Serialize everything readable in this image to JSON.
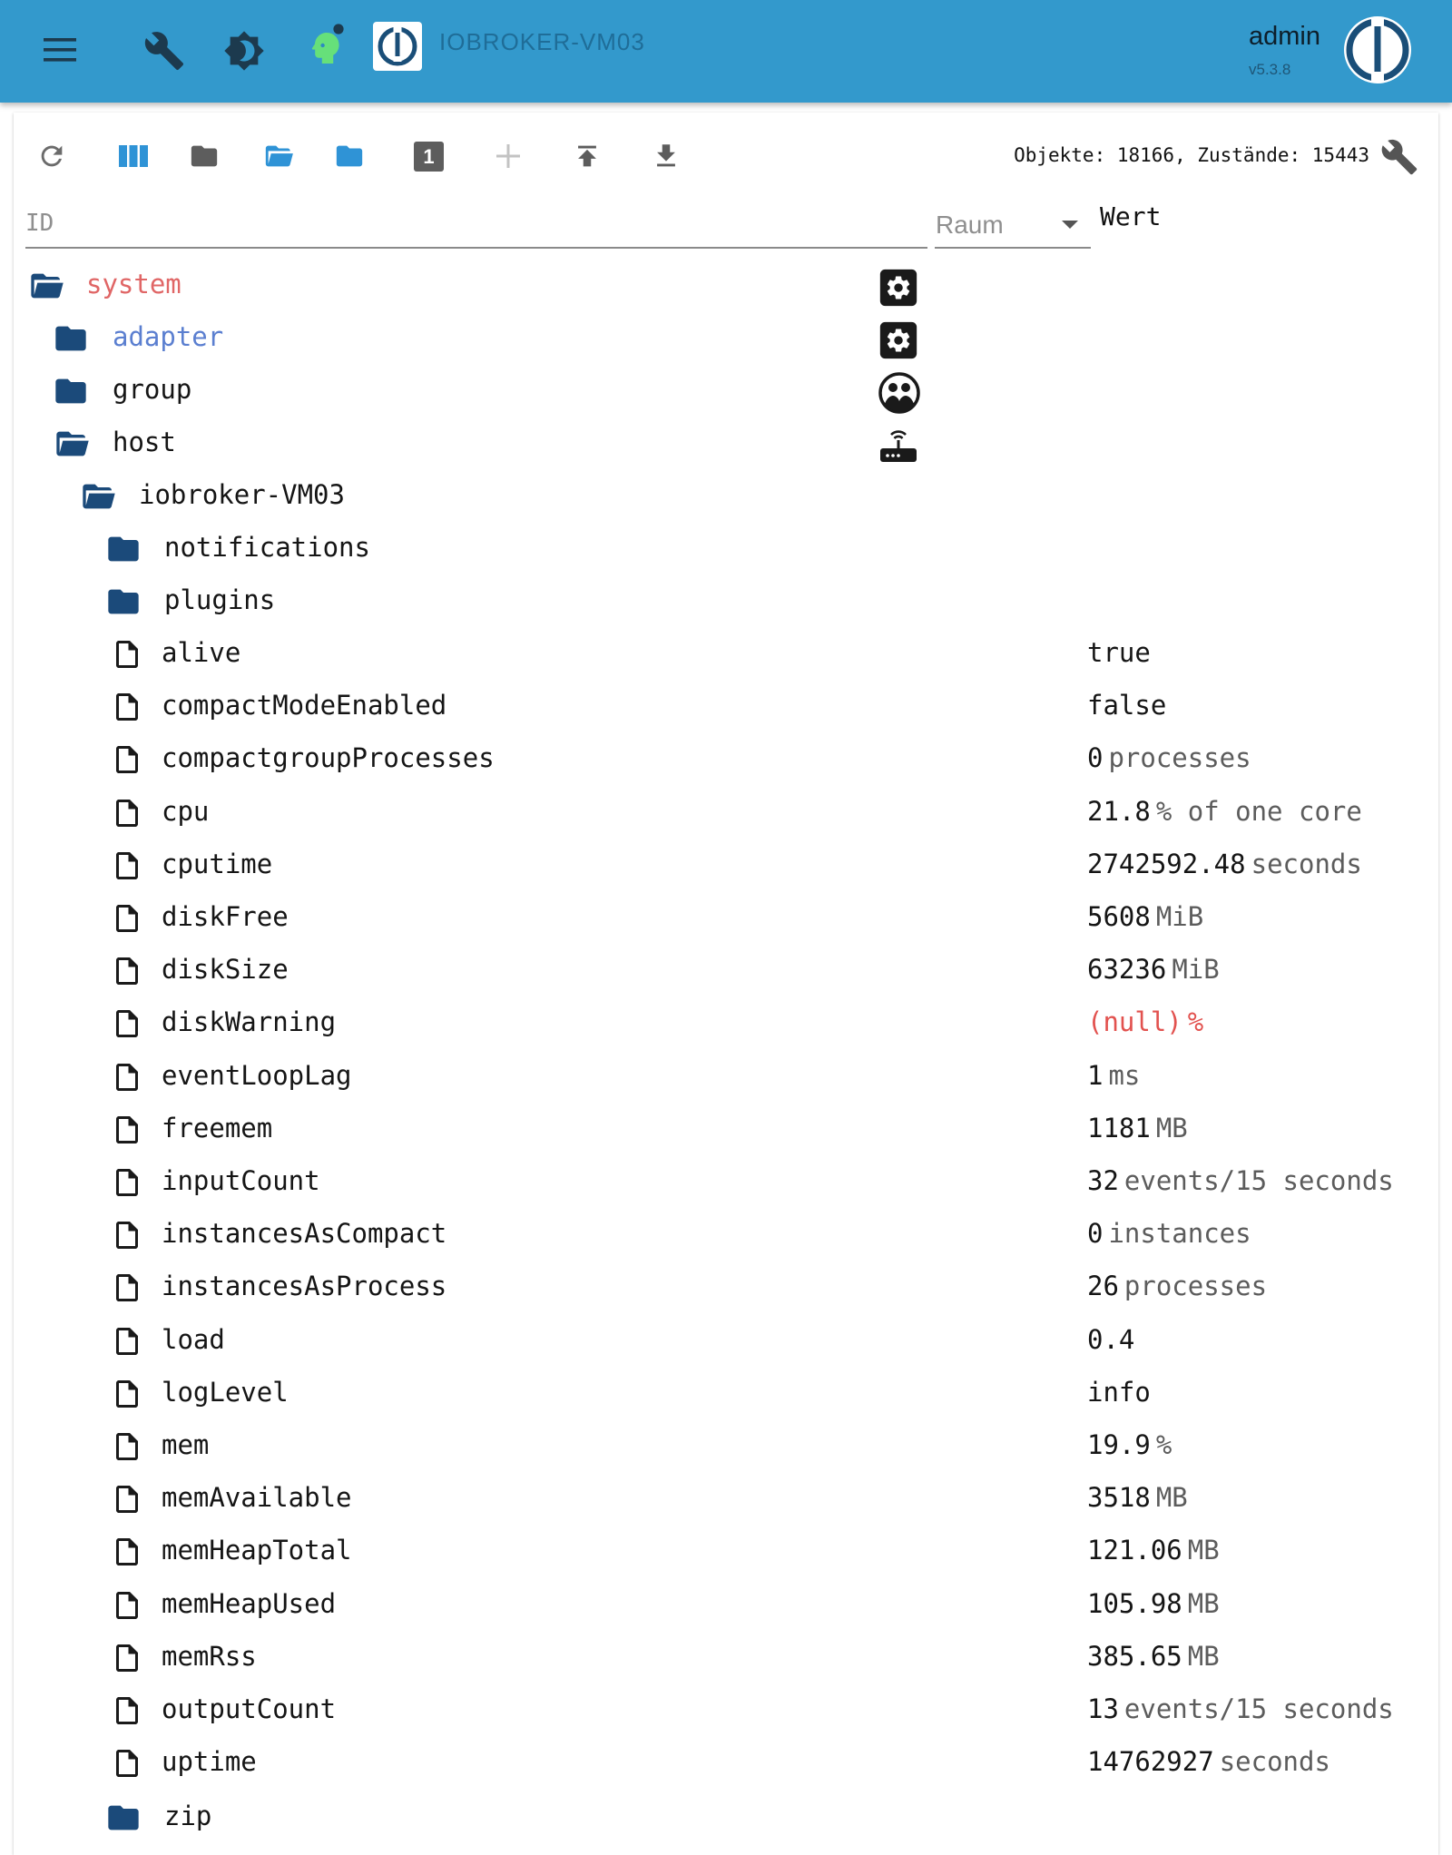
{
  "appbar": {
    "host_title": "IOBROKER-VM03",
    "user": "admin",
    "version": "v5.3.8",
    "colors": {
      "background": "#3399cc",
      "icons": "#1c3a4e",
      "accent": "#66e07a"
    }
  },
  "toolbar": {
    "stats": "Objekte: 18166, Zustände: 15443",
    "depth_badge": "1",
    "icons": [
      "refresh-icon",
      "columns-icon",
      "folder-icon",
      "folder-open-icon",
      "folder-icon",
      "depth-badge-icon",
      "add-icon",
      "upload-icon",
      "download-icon",
      "wrench-icon"
    ]
  },
  "filters": {
    "id_placeholder": "ID",
    "room_placeholder": "Raum",
    "value_header": "Wert"
  },
  "tree": {
    "colors": {
      "folder": "#1b4a7a",
      "system": "#e06666",
      "adapter": "#5b7fd0",
      "null_value": "#e2524f"
    },
    "system": {
      "label": "system"
    },
    "adapter": {
      "label": "adapter"
    },
    "group": {
      "label": "group"
    },
    "host": {
      "label": "host"
    },
    "host_instance": {
      "label": "iobroker-VM03"
    },
    "notifications": {
      "label": "notifications"
    },
    "plugins": {
      "label": "plugins"
    },
    "zip": {
      "label": "zip"
    },
    "states": [
      {
        "name": "alive",
        "value": "true",
        "unit": ""
      },
      {
        "name": "compactModeEnabled",
        "value": "false",
        "unit": ""
      },
      {
        "name": "compactgroupProcesses",
        "value": "0",
        "unit": "processes"
      },
      {
        "name": "cpu",
        "value": "21.8",
        "unit": "% of one core"
      },
      {
        "name": "cputime",
        "value": "2742592.48",
        "unit": "seconds"
      },
      {
        "name": "diskFree",
        "value": "5608",
        "unit": "MiB"
      },
      {
        "name": "diskSize",
        "value": "63236",
        "unit": "MiB"
      },
      {
        "name": "diskWarning",
        "value": "(null)",
        "unit": "%"
      },
      {
        "name": "eventLoopLag",
        "value": "1",
        "unit": "ms"
      },
      {
        "name": "freemem",
        "value": "1181",
        "unit": "MB"
      },
      {
        "name": "inputCount",
        "value": "32",
        "unit": "events/15 seconds"
      },
      {
        "name": "instancesAsCompact",
        "value": "0",
        "unit": "instances"
      },
      {
        "name": "instancesAsProcess",
        "value": "26",
        "unit": "processes"
      },
      {
        "name": "load",
        "value": "0.4",
        "unit": ""
      },
      {
        "name": "logLevel",
        "value": "info",
        "unit": ""
      },
      {
        "name": "mem",
        "value": "19.9",
        "unit": "%"
      },
      {
        "name": "memAvailable",
        "value": "3518",
        "unit": "MB"
      },
      {
        "name": "memHeapTotal",
        "value": "121.06",
        "unit": "MB"
      },
      {
        "name": "memHeapUsed",
        "value": "105.98",
        "unit": "MB"
      },
      {
        "name": "memRss",
        "value": "385.65",
        "unit": "MB"
      },
      {
        "name": "outputCount",
        "value": "13",
        "unit": "events/15 seconds"
      },
      {
        "name": "uptime",
        "value": "14762927",
        "unit": "seconds"
      }
    ]
  }
}
